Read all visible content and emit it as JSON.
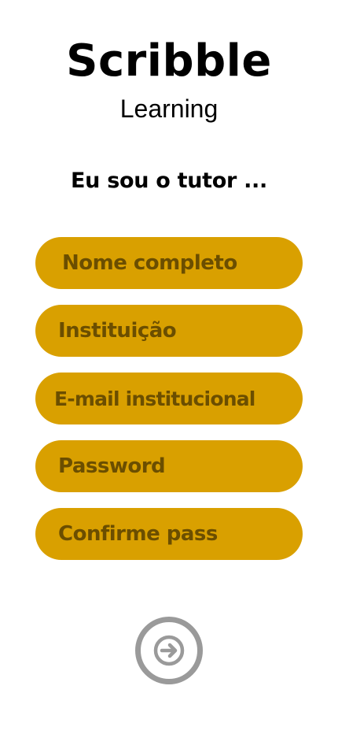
{
  "brand": {
    "title": "Scribble",
    "subtitle": "Learning"
  },
  "heading": "Eu sou o tutor ...",
  "form": {
    "fields": [
      {
        "placeholder": "Nome completo",
        "value": ""
      },
      {
        "placeholder": "Instituição",
        "value": ""
      },
      {
        "placeholder": "E-mail institucional",
        "value": ""
      },
      {
        "placeholder": "Password",
        "value": ""
      },
      {
        "placeholder": "Confirme pass",
        "value": ""
      }
    ],
    "next_icon": "arrow-right-circle-icon"
  },
  "colors": {
    "field_background": "#d9a000",
    "field_text": "#6b4e00",
    "next_button": "#9a9a9a"
  }
}
